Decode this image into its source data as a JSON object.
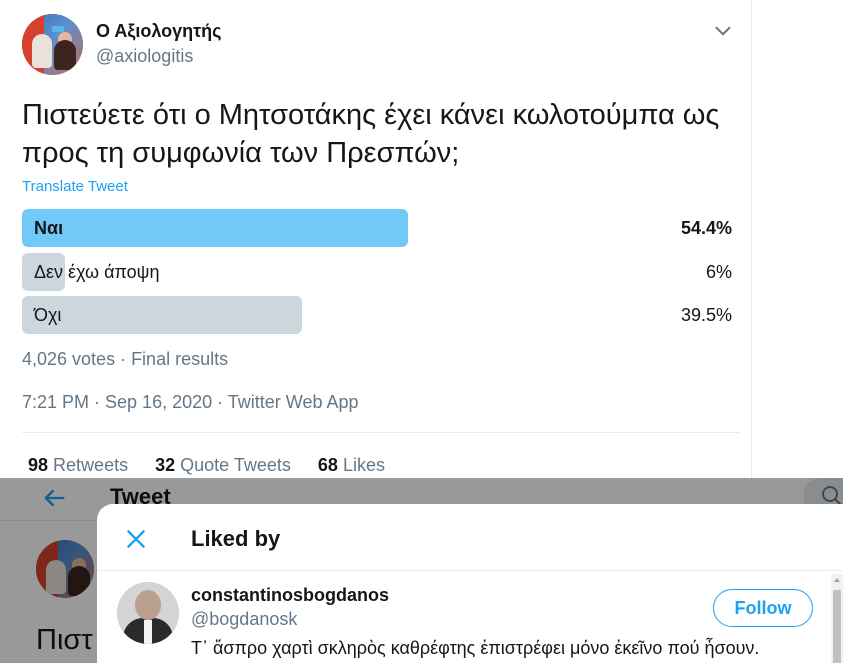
{
  "tweet": {
    "display_name": "Ο Αξιολογητής",
    "handle": "@axiologitis",
    "text": "Πιστεύετε ότι ο Μητσοτάκης έχει κάνει κωλοτούμπα ως προς τη συμφωνία των Πρεσπών;",
    "translate_label": "Translate Tweet",
    "menu_icon": "chevron-down-icon",
    "poll": {
      "options": [
        {
          "label": "Ναι",
          "percent_text": "54.4%",
          "fraction": 0.544,
          "winner": true,
          "color": "#71c9f8"
        },
        {
          "label": "Δεν έχω άποψη",
          "percent_text": "6%",
          "fraction": 0.06,
          "winner": false,
          "color": "#ccd6dd"
        },
        {
          "label": "Όχι",
          "percent_text": "39.5%",
          "fraction": 0.395,
          "winner": false,
          "color": "#ccd6dd"
        }
      ],
      "meta": "4,026 votes · Final results"
    },
    "timestamp": "7:21 PM · Sep 16, 2020 · Twitter Web App",
    "stats": {
      "retweets_count": "98",
      "retweets_label": "Retweets",
      "quotes_count": "32",
      "quotes_label": "Quote Tweets",
      "likes_count": "68",
      "likes_label": "Likes"
    }
  },
  "background_page": {
    "title": "Tweet",
    "back_icon": "arrow-left-icon",
    "search_icon": "search-icon",
    "text_fragment": "Πιστ"
  },
  "modal": {
    "title": "Liked by",
    "close_icon": "close-icon",
    "users": [
      {
        "name": "constantinosbogdanos",
        "handle": "@bogdanosk",
        "bio": "Τ᾽ ἄσπρο χαρτὶ σκληρὸς καθρέφτης ἐπιστρέφει μόνο ἐκεῖνο πού ἦσουν.",
        "follow_label": "Follow"
      }
    ]
  },
  "colors": {
    "accent": "#1da1f2",
    "secondary_text": "#657786",
    "poll_winner": "#71c9f8",
    "poll_other": "#ccd6dd"
  }
}
